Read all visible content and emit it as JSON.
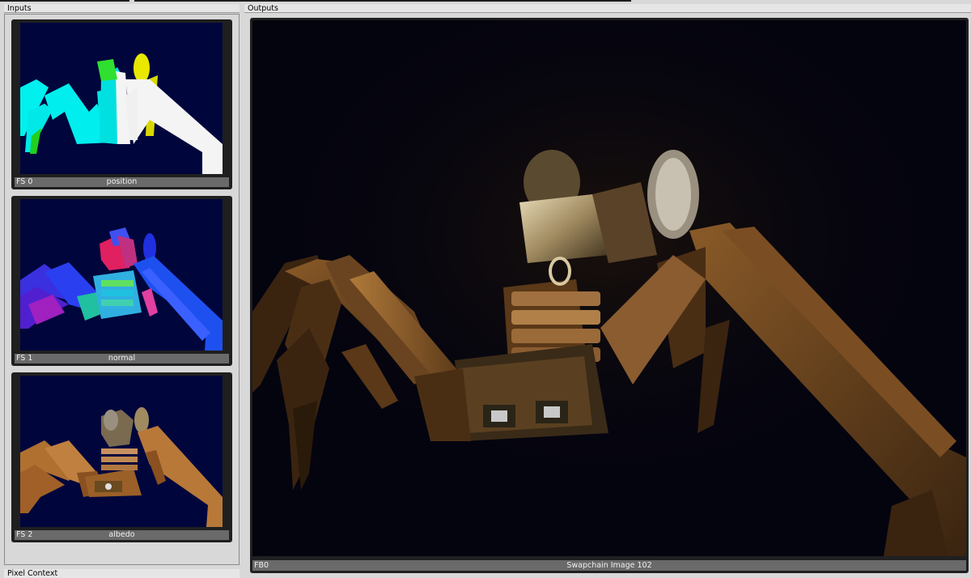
{
  "panels": {
    "inputs_title": "Inputs",
    "outputs_title": "Outputs",
    "pixel_context_title": "Pixel Context"
  },
  "inputs": [
    {
      "index": "FS 0",
      "name": "position"
    },
    {
      "index": "FS 1",
      "name": "normal"
    },
    {
      "index": "FS 2",
      "name": "albedo"
    }
  ],
  "output": {
    "index": "FB0",
    "name": "Swapchain Image 102"
  },
  "colors": {
    "viewport_bg": "#00063c",
    "output_bg": "#04040f",
    "label_bar": "#6a6a6a"
  }
}
